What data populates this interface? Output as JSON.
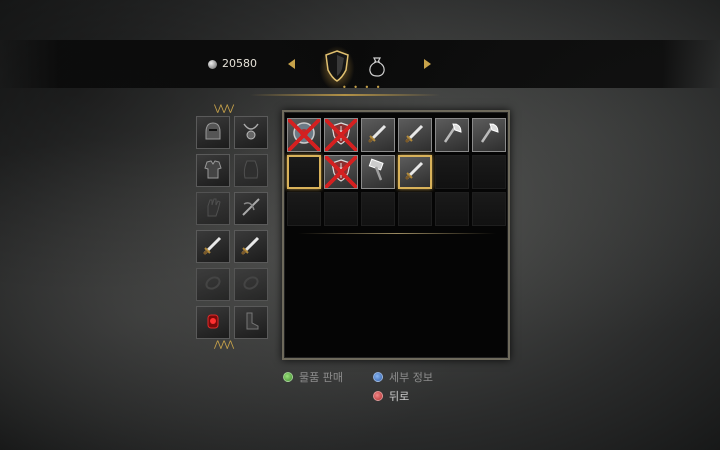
{
  "header": {
    "currency_value": "20580",
    "tabs": [
      {
        "name": "armor-shield-tab",
        "icon": "shield-icon",
        "selected": true
      },
      {
        "name": "items-bag-tab",
        "icon": "bag-icon",
        "selected": false
      }
    ],
    "page_dots": "• • • •"
  },
  "equipment": {
    "slots": [
      {
        "icon": "helmet-icon",
        "filled": true
      },
      {
        "icon": "amulet-icon",
        "filled": true
      },
      {
        "icon": "armor-icon",
        "filled": true
      },
      {
        "icon": "cape-icon",
        "filled": false
      },
      {
        "icon": "gauntlet-icon",
        "filled": false
      },
      {
        "icon": "crossbow-icon",
        "filled": true
      },
      {
        "icon": "sword-icon",
        "filled": true
      },
      {
        "icon": "sword-icon",
        "filled": true
      },
      {
        "icon": "ring-icon",
        "filled": false
      },
      {
        "icon": "ring-icon",
        "filled": false
      },
      {
        "icon": "red-lantern-icon",
        "filled": true
      },
      {
        "icon": "boots-icon",
        "filled": true
      }
    ]
  },
  "inventory": {
    "rows": 3,
    "columns": 6,
    "items": [
      {
        "icon": "round-shield-icon",
        "unusable": true
      },
      {
        "icon": "kite-shield-icon",
        "unusable": true
      },
      {
        "icon": "sword-icon",
        "unusable": false
      },
      {
        "icon": "sword-icon",
        "unusable": false
      },
      {
        "icon": "axe-icon",
        "unusable": false
      },
      {
        "icon": "axe-icon",
        "unusable": false
      },
      {
        "icon": "empty",
        "selected": true
      },
      {
        "icon": "kite-shield-icon",
        "unusable": true
      },
      {
        "icon": "hammer-icon",
        "unusable": false
      },
      {
        "icon": "sword-icon",
        "unusable": false,
        "highlighted": true
      }
    ]
  },
  "hints": {
    "sell": "물품 판매",
    "details": "세부 정보",
    "back": "뒤로"
  },
  "colors": {
    "accent_gold": "#c7a24a",
    "unusable_red": "#d42020"
  }
}
